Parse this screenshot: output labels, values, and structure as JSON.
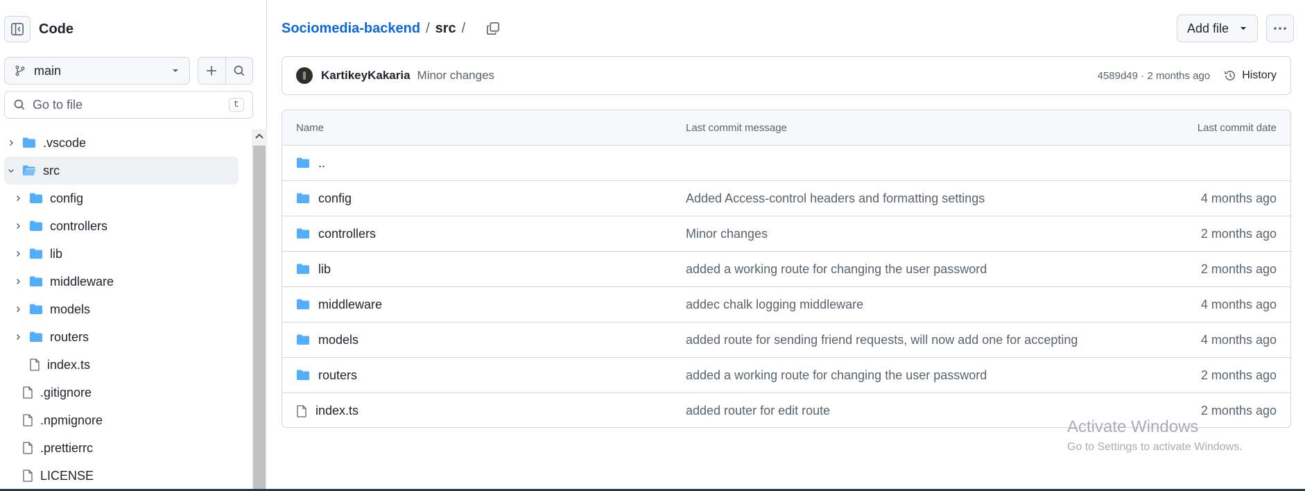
{
  "sidebar": {
    "title": "Code",
    "branch": "main",
    "goto_placeholder": "Go to file",
    "goto_shortcut": "t",
    "tree": [
      {
        "label": ".vscode",
        "kind": "folder",
        "depth": 0,
        "chevron": "right",
        "selected": false
      },
      {
        "label": "src",
        "kind": "folder-open",
        "depth": 0,
        "chevron": "down",
        "selected": true
      },
      {
        "label": "config",
        "kind": "folder",
        "depth": 1,
        "chevron": "right",
        "selected": false
      },
      {
        "label": "controllers",
        "kind": "folder",
        "depth": 1,
        "chevron": "right",
        "selected": false
      },
      {
        "label": "lib",
        "kind": "folder",
        "depth": 1,
        "chevron": "right",
        "selected": false
      },
      {
        "label": "middleware",
        "kind": "folder",
        "depth": 1,
        "chevron": "right",
        "selected": false
      },
      {
        "label": "models",
        "kind": "folder",
        "depth": 1,
        "chevron": "right",
        "selected": false
      },
      {
        "label": "routers",
        "kind": "folder",
        "depth": 1,
        "chevron": "right",
        "selected": false
      },
      {
        "label": "index.ts",
        "kind": "file",
        "depth": 1,
        "chevron": "none",
        "selected": false
      },
      {
        "label": ".gitignore",
        "kind": "file",
        "depth": 0,
        "chevron": "none",
        "selected": false
      },
      {
        "label": ".npmignore",
        "kind": "file",
        "depth": 0,
        "chevron": "none",
        "selected": false
      },
      {
        "label": ".prettierrc",
        "kind": "file",
        "depth": 0,
        "chevron": "none",
        "selected": false
      },
      {
        "label": "LICENSE",
        "kind": "file",
        "depth": 0,
        "chevron": "none",
        "selected": false
      }
    ]
  },
  "breadcrumb": {
    "repo": "Sociomedia-backend",
    "sep1": "/",
    "dir": "src",
    "sep2": "/"
  },
  "toolbar": {
    "add_file": "Add file"
  },
  "commit": {
    "author": "KartikeyKakaria",
    "message": "Minor changes",
    "meta": "4589d49 · 2 months ago",
    "history": "History"
  },
  "table": {
    "headers": {
      "name": "Name",
      "message": "Last commit message",
      "date": "Last commit date"
    },
    "rows": [
      {
        "name": "..",
        "kind": "folder",
        "message": "",
        "date": ""
      },
      {
        "name": "config",
        "kind": "folder",
        "message": "Added Access-control headers and formatting settings",
        "date": "4 months ago"
      },
      {
        "name": "controllers",
        "kind": "folder",
        "message": "Minor changes",
        "date": "2 months ago"
      },
      {
        "name": "lib",
        "kind": "folder",
        "message": "added a working route for changing the user password",
        "date": "2 months ago"
      },
      {
        "name": "middleware",
        "kind": "folder",
        "message": "addec chalk logging middleware",
        "date": "4 months ago"
      },
      {
        "name": "models",
        "kind": "folder",
        "message": "added route for sending friend requests, will now add one for accepting",
        "date": "4 months ago"
      },
      {
        "name": "routers",
        "kind": "folder",
        "message": "added a working route for changing the user password",
        "date": "2 months ago"
      },
      {
        "name": "index.ts",
        "kind": "file",
        "message": "added router for edit route",
        "date": "2 months ago"
      }
    ]
  },
  "watermark": {
    "line1": "Activate Windows",
    "line2": "Go to Settings to activate Windows."
  },
  "colors": {
    "accent": "#0969da",
    "folder": "#54aeff",
    "border": "#d0d7de",
    "muted": "#59636e"
  }
}
